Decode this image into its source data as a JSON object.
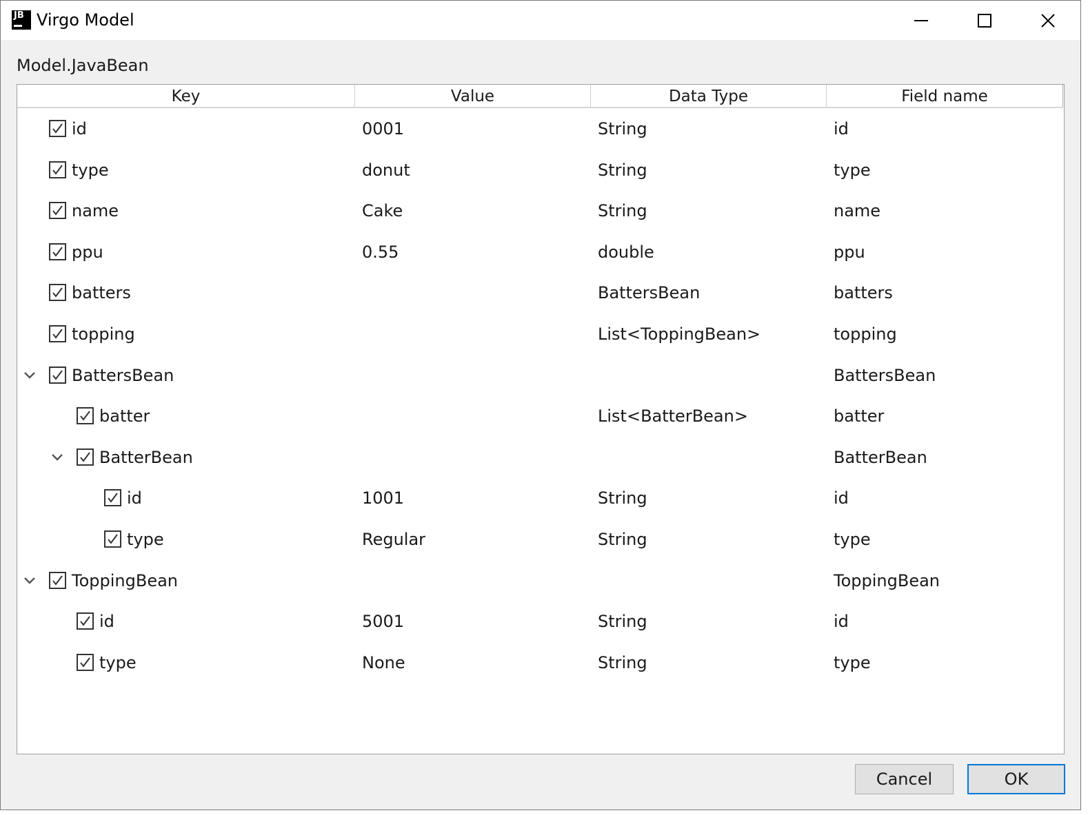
{
  "window": {
    "title": "Virgo Model",
    "logo_text": "JB"
  },
  "model_label": "Model.JavaBean",
  "columns": [
    "Key",
    "Value",
    "Data Type",
    "Field name"
  ],
  "rows": [
    {
      "level": 0,
      "expand": false,
      "checked": true,
      "key": "id",
      "value": "0001",
      "type": "String",
      "field": "id"
    },
    {
      "level": 0,
      "expand": false,
      "checked": true,
      "key": "type",
      "value": "donut",
      "type": "String",
      "field": "type"
    },
    {
      "level": 0,
      "expand": false,
      "checked": true,
      "key": "name",
      "value": "Cake",
      "type": "String",
      "field": "name"
    },
    {
      "level": 0,
      "expand": false,
      "checked": true,
      "key": "ppu",
      "value": "0.55",
      "type": "double",
      "field": "ppu"
    },
    {
      "level": 0,
      "expand": false,
      "checked": true,
      "key": "batters",
      "value": "",
      "type": "BattersBean",
      "field": "batters"
    },
    {
      "level": 0,
      "expand": false,
      "checked": true,
      "key": "topping",
      "value": "",
      "type": "List<ToppingBean>",
      "field": "topping"
    },
    {
      "level": 0,
      "expand": true,
      "checked": true,
      "key": "BattersBean",
      "value": "",
      "type": "",
      "field": "BattersBean"
    },
    {
      "level": 1,
      "expand": false,
      "checked": true,
      "key": "batter",
      "value": "",
      "type": "List<BatterBean>",
      "field": "batter"
    },
    {
      "level": 1,
      "expand": true,
      "checked": true,
      "key": "BatterBean",
      "value": "",
      "type": "",
      "field": "BatterBean"
    },
    {
      "level": 2,
      "expand": false,
      "checked": true,
      "key": "id",
      "value": "1001",
      "type": "String",
      "field": "id"
    },
    {
      "level": 2,
      "expand": false,
      "checked": true,
      "key": "type",
      "value": "Regular",
      "type": "String",
      "field": "type"
    },
    {
      "level": 0,
      "expand": true,
      "checked": true,
      "key": "ToppingBean",
      "value": "",
      "type": "",
      "field": "ToppingBean"
    },
    {
      "level": 1,
      "expand": false,
      "checked": true,
      "key": "id",
      "value": "5001",
      "type": "String",
      "field": "id"
    },
    {
      "level": 1,
      "expand": false,
      "checked": true,
      "key": "type",
      "value": "None",
      "type": "String",
      "field": "type"
    }
  ],
  "buttons": {
    "cancel": "Cancel",
    "ok": "OK"
  },
  "colors": {
    "focus_border": "#0078d7",
    "window_bg": "#f0f0f0"
  }
}
